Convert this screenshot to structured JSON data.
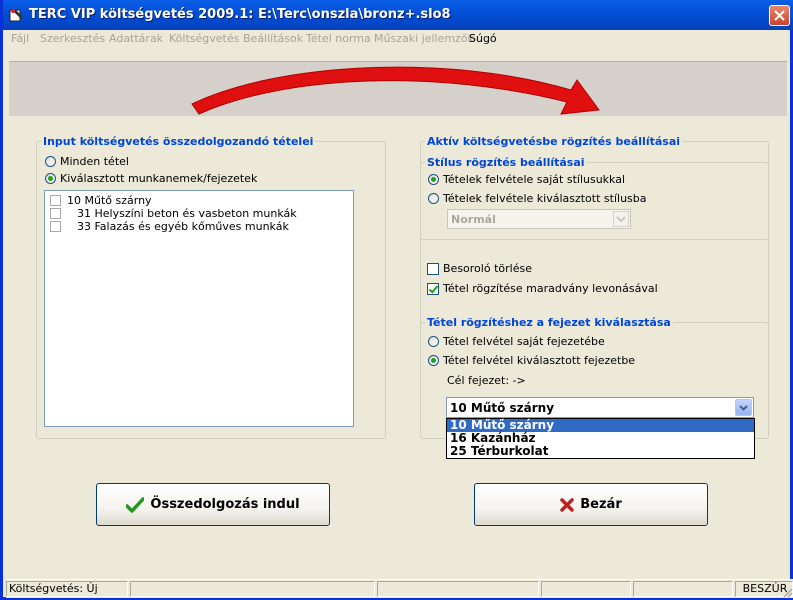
{
  "window": {
    "title": "TERC VIP költségvetés 2009.1:  E:\\Terc\\onszla\\bronz+.slo8",
    "icon": "app-icon"
  },
  "menu": [
    "Fájl",
    "Szerkesztés",
    "Adattárak",
    "Költségvetés",
    "Beállítások",
    "Tétel norma",
    "Műszaki jellemzők",
    "Súgó"
  ],
  "input_group": {
    "title": "Input költségvetés összedolgozandó tételei",
    "options": [
      "Minden tétel",
      "Kiválasztott munkanemek/fejezetek"
    ],
    "selected": 1,
    "items": [
      "10 Műtő szárny",
      "31 Helyszíni beton és vasbeton munkák",
      "33 Falazás és egyéb kőműves munkák"
    ]
  },
  "settings_group": {
    "title": "Aktív költségvetésbe rögzítés beállításai",
    "style_group": {
      "title": "Stílus rögzítés beállításai",
      "options": [
        "Tételek felvétele saját stílusukkal",
        "Tételek felvétele kiválasztott stílusba"
      ],
      "selected": 0,
      "style_combo_value": "Normál"
    },
    "checks": {
      "besorolo_label": "Besoroló törlése",
      "besorolo_checked": false,
      "maradvany_label": "Tétel rögzítése maradvány levonásával",
      "maradvany_checked": true
    },
    "chapter_group": {
      "title": "Tétel rögzítéshez a fejezet kiválasztása",
      "options": [
        "Tétel felvétel saját fejezetébe",
        "Tétel felvétel kiválasztott fejezetbe"
      ],
      "selected": 1,
      "target_label": "Cél fejezet: ->",
      "combo_value": "10 Műtő szárny",
      "dropdown_items": [
        "10 Műtő szárny",
        "16 Kazánház",
        "25 Térburkolat"
      ],
      "dropdown_selected": 0
    }
  },
  "buttons": {
    "merge_label": "Összedolgozás indul",
    "close_label": "Bezár"
  },
  "status": {
    "left": "Költségvetés: Új",
    "mode": "BESZÚR"
  },
  "colors": {
    "accent": "#0046d5",
    "titlebar": "#0550d6",
    "selection": "#316ac5",
    "arrow": "#e01010"
  }
}
